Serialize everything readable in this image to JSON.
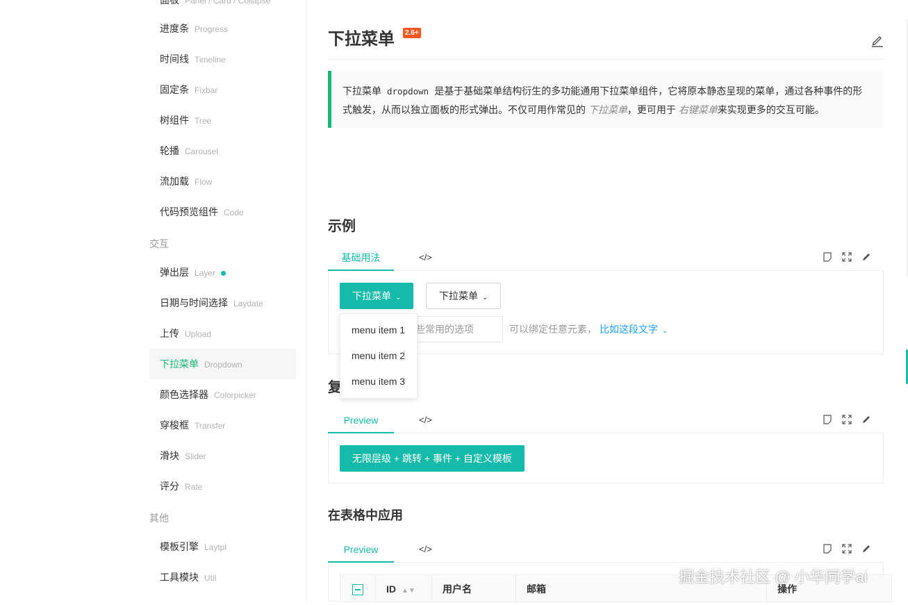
{
  "sidebar": {
    "top_partial": "面板",
    "items": [
      {
        "zh": "进度条",
        "en": "Progress"
      },
      {
        "zh": "时间线",
        "en": "Timeline"
      },
      {
        "zh": "固定条",
        "en": "Fixbar"
      },
      {
        "zh": "树组件",
        "en": "Tree"
      },
      {
        "zh": "轮播",
        "en": "Carousel"
      },
      {
        "zh": "流加载",
        "en": "Flow"
      },
      {
        "zh": "代码预览组件",
        "en": "Code"
      }
    ],
    "group_interaction": "交互",
    "interaction_items": [
      {
        "zh": "弹出层",
        "en": "Layer"
      },
      {
        "zh": "日期与时间选择",
        "en": "Laydate"
      },
      {
        "zh": "上传",
        "en": "Upload"
      },
      {
        "zh": "下拉菜单",
        "en": "Dropdown"
      },
      {
        "zh": "颜色选择器",
        "en": "Colorpicker"
      },
      {
        "zh": "穿梭框",
        "en": "Transfer"
      },
      {
        "zh": "滑块",
        "en": "Slider"
      },
      {
        "zh": "评分",
        "en": "Rate"
      }
    ],
    "group_other": "其他",
    "other_items": [
      {
        "zh": "模板引擎",
        "en": "Laytpl"
      },
      {
        "zh": "工具模块",
        "en": "Util"
      }
    ]
  },
  "page": {
    "title": "下拉菜单",
    "version_badge": "2.6+",
    "intro_1": "下拉菜单",
    "intro_code": "dropdown",
    "intro_2": "是基于基础菜单结构衍生的多功能通用下拉菜单组件，它将原本静态呈现的菜单，通过各种事件的形式触发，从而以独立面板的形式弹出。不仅可用作常见的",
    "intro_em1": "下拉菜单",
    "intro_3": "，更可用于",
    "intro_em2": "右键菜单",
    "intro_4": "来实现更多的交互可能。"
  },
  "examples": {
    "heading": "示例",
    "tab1_label": "基础用法",
    "code_tab_label": "</>",
    "preview_label": "Preview",
    "btn_dropdown_primary": "下拉菜单",
    "btn_dropdown_default": "下拉菜单",
    "input_text": "些常用的选项",
    "hint_text": "可以绑定任意元素，",
    "link_text": "比如这段文字",
    "menu_items": [
      "menu item 1",
      "menu item 2",
      "menu item 3"
    ],
    "heading2_partial": "复",
    "btn_complex": "无限层级 + 跳转 + 事件 + 自定义模板",
    "heading3": "在表格中应用"
  },
  "table": {
    "columns": [
      "ID",
      "用户名",
      "邮箱",
      "操作"
    ]
  },
  "watermark": "掘金技术社区 @ 小华同学ai",
  "colors": {
    "accent": "#16baaa",
    "nav_active": "#16b777",
    "badge": "#ff5722",
    "link": "#1e9fff"
  }
}
